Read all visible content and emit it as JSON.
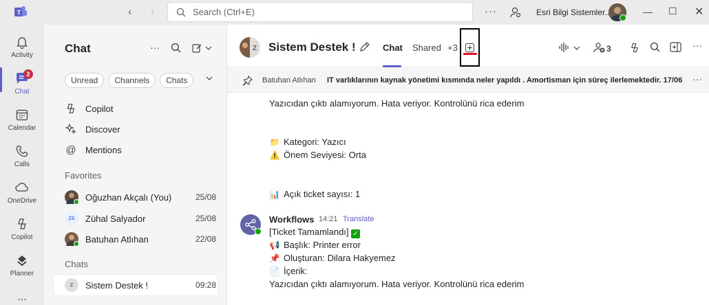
{
  "titlebar": {
    "search_placeholder": "Search (Ctrl+E)",
    "org_name": "Esri Bilgi Sistemler..."
  },
  "rail": {
    "items": [
      {
        "label": "Activity",
        "icon": "bell-icon"
      },
      {
        "label": "Chat",
        "icon": "chat-icon",
        "badge": "2"
      },
      {
        "label": "Calendar",
        "icon": "calendar-icon"
      },
      {
        "label": "Calls",
        "icon": "phone-icon"
      },
      {
        "label": "OneDrive",
        "icon": "cloud-icon"
      },
      {
        "label": "Copilot",
        "icon": "copilot-icon"
      },
      {
        "label": "Planner",
        "icon": "planner-icon"
      }
    ],
    "more": "..."
  },
  "chat_panel": {
    "title": "Chat",
    "filters": [
      "Unread",
      "Channels",
      "Chats"
    ],
    "quick": [
      {
        "label": "Copilot",
        "icon": "copilot-icon"
      },
      {
        "label": "Discover",
        "icon": "sparkle-icon"
      },
      {
        "label": "Mentions",
        "icon": "at-icon"
      }
    ],
    "favorites_label": "Favorites",
    "favorites": [
      {
        "name": "Oğuzhan Akçalı (You)",
        "date": "25/08"
      },
      {
        "name": "Zühal Salyador",
        "date": "25/08",
        "initials": "ZS"
      },
      {
        "name": "Batuhan Atlıhan",
        "date": "22/08"
      }
    ],
    "chats_label": "Chats",
    "chats": [
      {
        "name": "Sistem Destek !",
        "date": "09:28"
      }
    ]
  },
  "header": {
    "title": "Sistem Destek !",
    "group_initial": "Z",
    "tabs": [
      "Chat",
      "Shared",
      "+3"
    ],
    "participants_count": "3"
  },
  "pinned": {
    "author": "Batuhan Atlıhan",
    "text": "IT varlıklarının kaynak yönetimi kısmında neler yapıldı . Amortisman için süreç ilerlemektedir. 17/06"
  },
  "messages": {
    "line1": "Yazıcıdan çıktı alamıyorum. Hata veriyor. Kontrolünü rica ederim",
    "kategori": "Kategori: Yazıcı",
    "onem": "Önem Seviyesi: Orta",
    "ticket_count": "Açık ticket sayısı: 1",
    "wf_name": "Workflows",
    "wf_time": "14:21",
    "wf_translate": "Translate",
    "tamam": "[Ticket Tamamlandı]",
    "baslik": "Başlık: Printer error",
    "olusturan": "Oluşturan: Dilara Hakyemez",
    "icerik": "İçerik:",
    "line_last": "Yazıcıdan çıktı alamıyorum. Hata veriyor. Kontrolünü rica ederim"
  }
}
